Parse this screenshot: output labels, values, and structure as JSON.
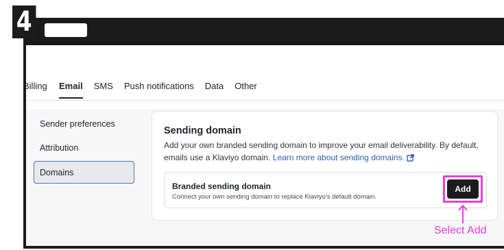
{
  "step": {
    "number": "4"
  },
  "tabs": [
    {
      "label": "Billing",
      "active": false
    },
    {
      "label": "Email",
      "active": true
    },
    {
      "label": "SMS",
      "active": false
    },
    {
      "label": "Push notifications",
      "active": false
    },
    {
      "label": "Data",
      "active": false
    },
    {
      "label": "Other",
      "active": false
    }
  ],
  "sidebar": {
    "items": [
      {
        "label": "Sender preferences",
        "active": false
      },
      {
        "label": "Attribution",
        "active": false
      },
      {
        "label": "Domains",
        "active": true
      }
    ]
  },
  "sending_domain": {
    "title": "Sending domain",
    "description": "Add your own branded sending domain to improve your email deliverability. By default, emails use a Klaviyo domain.",
    "link_text": "Learn more about sending domains.",
    "link_icon": "external-link-icon"
  },
  "branded_domain": {
    "title": "Branded sending domain",
    "description": "Connect your own sending domain to replace Klaviyo's default domain.",
    "button_label": "Add"
  },
  "annotation": {
    "text": "Select Add",
    "color": "#e93ee0"
  },
  "colors": {
    "accent_link": "#2c5fa8",
    "active_border": "#4a78b5",
    "dark": "#1c1c1c"
  }
}
